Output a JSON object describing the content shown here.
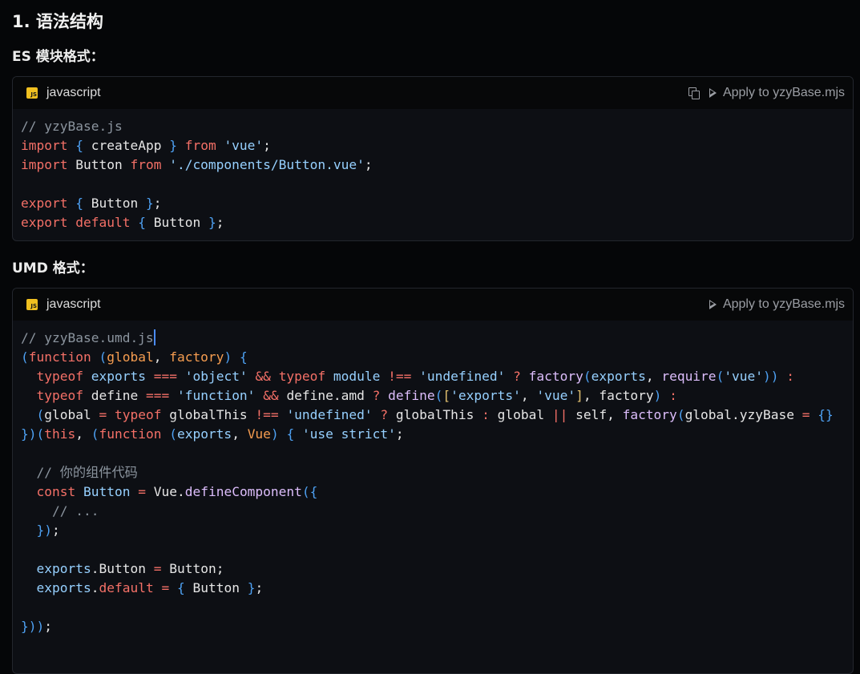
{
  "heading": "1. 语法结构",
  "es_label": "ES 模块格式：",
  "umd_label": "UMD 格式：",
  "block1": {
    "lang": "javascript",
    "apply": "Apply to yzyBase.mjs",
    "icons": [
      "js-badge-icon",
      "copy-icon",
      "play-icon"
    ]
  },
  "block2": {
    "lang": "javascript",
    "apply": "Apply to yzyBase.mjs",
    "icons": [
      "js-badge-icon",
      "play-icon"
    ]
  },
  "code1": [
    "// yzyBase.js",
    "import { createApp } from 'vue';",
    "import Button from './components/Button.vue';",
    "",
    "export { Button };",
    "export default { Button };"
  ],
  "code2": [
    "// yzyBase.umd.js",
    "(function (global, factory) {",
    "  typeof exports === 'object' && typeof module !== 'undefined' ? factory(exports, require('vue')) :",
    "  typeof define === 'function' && define.amd ? define(['exports', 'vue'], factory) :",
    "  (global = typeof globalThis !== 'undefined' ? globalThis : global || self, factory(global.yzyBase = {}",
    "})(this, (function (exports, Vue) { 'use strict';",
    "",
    "  // 你的组件代码",
    "  const Button = Vue.defineComponent({",
    "    // ...",
    "  });",
    "",
    "  exports.Button = Button;",
    "  exports.default = { Button };",
    "",
    "}));"
  ],
  "colors": {
    "keyword": "#f47067",
    "string": "#96d0ff",
    "function": "#dcbdfb",
    "comment": "#8b949e",
    "bracket1": "#4ea1f3",
    "bracket2": "#e3c16f",
    "param": "#f69d50",
    "plain": "#e6e6e6"
  }
}
